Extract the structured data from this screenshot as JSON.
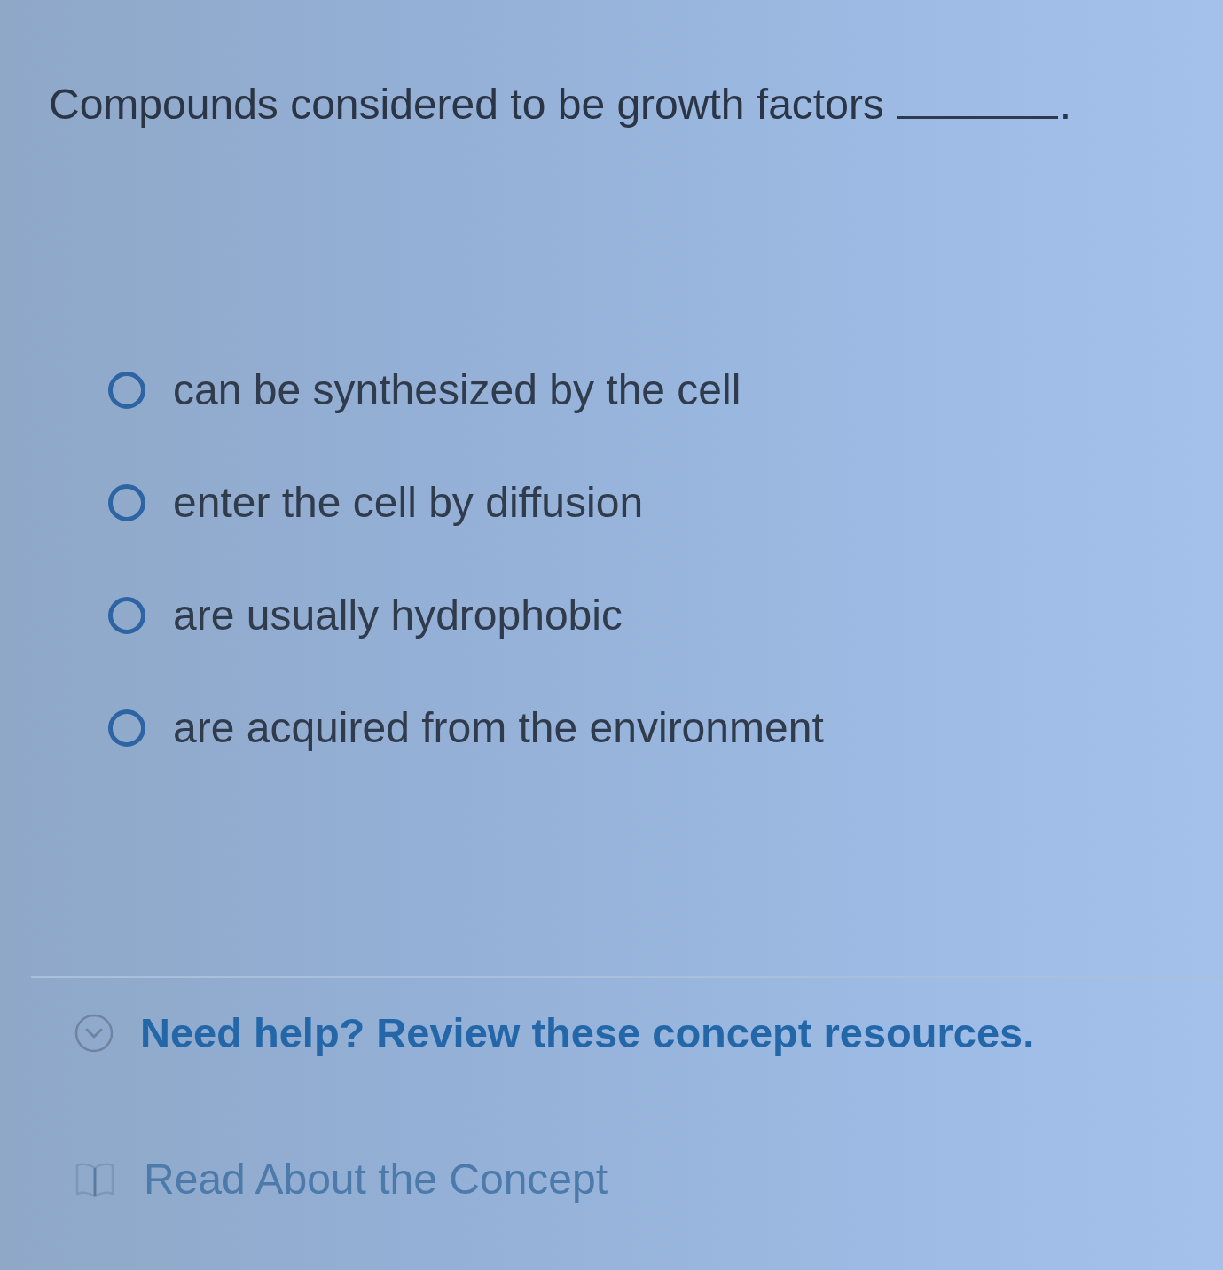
{
  "question": {
    "text": "Compounds considered to be growth factors",
    "after_blank": "."
  },
  "options": [
    {
      "label": "can be synthesized by the cell",
      "selected": false
    },
    {
      "label": "enter the cell by diffusion",
      "selected": false
    },
    {
      "label": "are usually hydrophobic",
      "selected": false
    },
    {
      "label": "are acquired from the environment",
      "selected": false
    }
  ],
  "help": {
    "text": "Need help? Review these concept resources."
  },
  "resources": [
    {
      "label": "Read About the Concept"
    }
  ]
}
